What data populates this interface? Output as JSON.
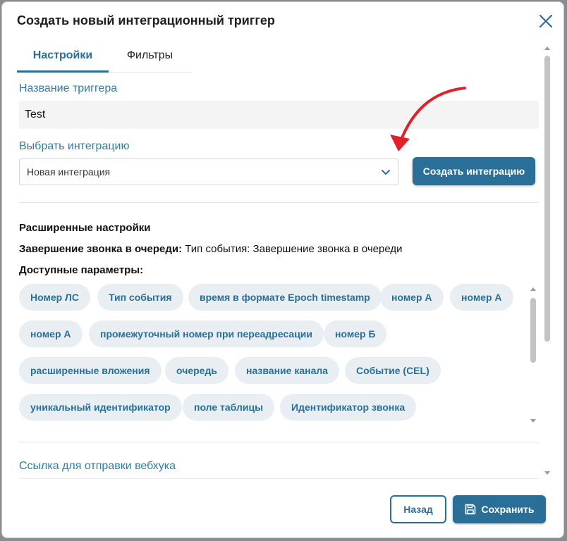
{
  "modal": {
    "title": "Создать новый интеграционный триггер",
    "close_icon": "close-icon"
  },
  "tabs": [
    {
      "label": "Настройки",
      "active": true
    },
    {
      "label": "Фильтры",
      "active": false
    }
  ],
  "trigger_name": {
    "label": "Название триггера",
    "value": "Test"
  },
  "integration": {
    "label": "Выбрать интеграцию",
    "selected": "Новая интеграция",
    "create_button": "Создать интеграцию"
  },
  "advanced": {
    "title": "Расширенные настройки",
    "event_label": "Завершение звонка в очереди:",
    "event_value": "Тип события: Завершение звонка в очереди",
    "params_label": "Доступные параметры:"
  },
  "params": [
    "Номер ЛС",
    "Тип события",
    "время в формате Epoch timestamp",
    "номер А",
    "номер А",
    "номер А",
    "промежуточный номер при переадресации",
    "номер Б",
    "расширенные вложения",
    "очередь",
    "название канала",
    "Событие (CEL)",
    "уникальный идентификатор",
    "поле таблицы",
    "Идентификатор звонка"
  ],
  "webhook": {
    "label": "Ссылка для отправки вебхука"
  },
  "footer": {
    "back_label": "Назад",
    "save_label": "Сохранить"
  },
  "colors": {
    "accent": "#2a6f97",
    "label": "#2f7ca8",
    "chip_bg": "#e8eef2",
    "arrow": "#e0202a"
  }
}
